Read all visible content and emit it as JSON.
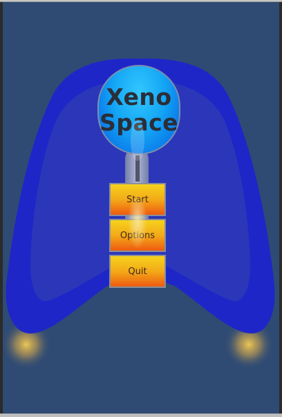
{
  "game": {
    "title_line1": "Xeno",
    "title_line2": "Space"
  },
  "menu": {
    "start_label": "Start",
    "options_label": "Options",
    "quit_label": "Quit"
  },
  "colors": {
    "background": "#2f4b73",
    "ship_hull": "#1f26c8",
    "ship_inner": "#2a36b8",
    "logo_blue": "#14a6f4",
    "button_top": "#f6d21c",
    "button_bottom": "#ee5a10",
    "thruster_glow": "#f2c64a"
  }
}
